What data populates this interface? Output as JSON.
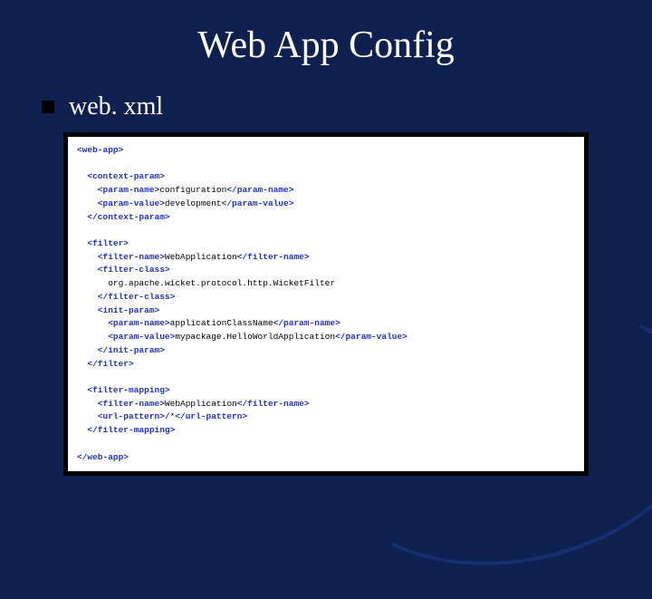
{
  "slide": {
    "title": "Web App Config",
    "bullet_label": "web. xml"
  },
  "code": {
    "l01a": "<web-app>",
    "l02": "",
    "l03a": "  <context-param>",
    "l04a": "    <param-name>",
    "l04t": "configuration",
    "l04b": "</param-name>",
    "l05a": "    <param-value>",
    "l05t": "development",
    "l05b": "</param-value>",
    "l06a": "  </context-param>",
    "l07": "",
    "l08a": "  <filter>",
    "l09a": "    <filter-name>",
    "l09t": "WebApplication",
    "l09b": "</filter-name>",
    "l10a": "    <filter-class>",
    "l11t": "      org.apache.wicket.protocol.http.WicketFilter",
    "l12a": "    </filter-class>",
    "l13a": "    <init-param>",
    "l14a": "      <param-name>",
    "l14t": "applicationClassName",
    "l14b": "</param-name>",
    "l15a": "      <param-value>",
    "l15t": "mypackage.HelloWorldApplication",
    "l15b": "</param-value>",
    "l16a": "    </init-param>",
    "l17a": "  </filter>",
    "l18": "",
    "l19a": "  <filter-mapping>",
    "l20a": "    <filter-name>",
    "l20t": "WebApplication",
    "l20b": "</filter-name>",
    "l21a": "    <url-pattern>",
    "l21t": "/*",
    "l21b": "</url-pattern>",
    "l22a": "  </filter-mapping>",
    "l23": "",
    "l24a": "</web-app>"
  }
}
